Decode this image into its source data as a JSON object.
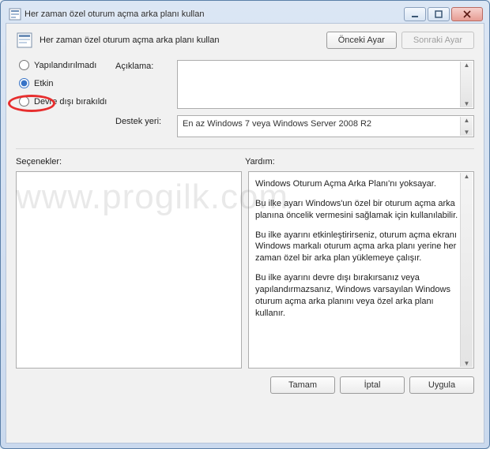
{
  "window": {
    "title": "Her zaman özel oturum açma arka planı kullan"
  },
  "header": {
    "policy_title": "Her zaman özel oturum açma arka planı kullan",
    "prev_btn": "Önceki Ayar",
    "next_btn": "Sonraki Ayar"
  },
  "radios": {
    "not_configured": "Yapılandırılmadı",
    "enabled": "Etkin",
    "disabled": "Devre dışı bırakıldı",
    "selected": "enabled"
  },
  "labels": {
    "description": "Açıklama:",
    "supported": "Destek yeri:",
    "options": "Seçenekler:",
    "help": "Yardım:"
  },
  "supported_text": "En az Windows 7 veya Windows Server 2008 R2",
  "help": {
    "p1": "Windows Oturum Açma Arka Planı'nı yoksayar.",
    "p2": "Bu ilke ayarı Windows'un özel bir oturum açma arka planına öncelik vermesini sağlamak için kullanılabilir.",
    "p3": "Bu ilke ayarını etkinleştirirseniz, oturum açma ekranı Windows markalı oturum açma arka planı yerine her zaman özel bir arka plan yüklemeye çalışır.",
    "p4": "Bu ilke ayarını devre dışı bırakırsanız veya yapılandırmazsanız, Windows varsayılan Windows oturum açma arka planını veya özel arka planı kullanır."
  },
  "footer": {
    "ok": "Tamam",
    "cancel": "İptal",
    "apply": "Uygula"
  },
  "watermark": "www.progilk.com"
}
